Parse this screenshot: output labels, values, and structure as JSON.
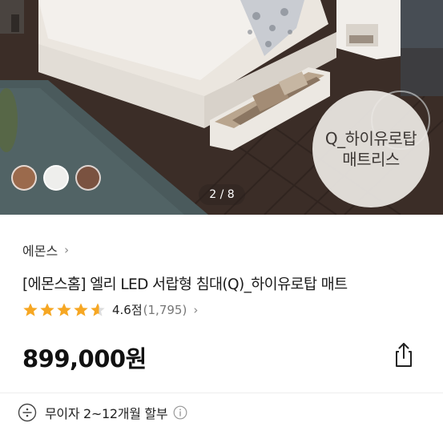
{
  "gallery": {
    "color_options": [
      {
        "name": "brown-option",
        "color": "#9b6a4c"
      },
      {
        "name": "white-option",
        "color": "#eeeeec"
      },
      {
        "name": "walnut-option",
        "color": "#7a5240"
      }
    ],
    "page_indicator": "2 / 8",
    "overlay_badge": {
      "line1": "Q_하이유로탑",
      "line2": "매트리스"
    }
  },
  "product": {
    "brand": "에몬스",
    "brand_chevron": "›",
    "title": "[에몬스홈] 엘리 LED 서랍형 침대(Q)_하이유로탑 매트",
    "rating": {
      "stars": 4.6,
      "value": "4.6점",
      "count": "(1,795)",
      "chevron": "›"
    },
    "price": "899,000원",
    "share_icon": "share-icon"
  },
  "payment": {
    "installment_text": "무이자 2~12개월 할부",
    "icon": "divide-icon",
    "info_icon": "info-icon"
  },
  "colors": {
    "star": "#f6a723",
    "star_empty": "#dddddd",
    "text": "#1a1a1a"
  }
}
